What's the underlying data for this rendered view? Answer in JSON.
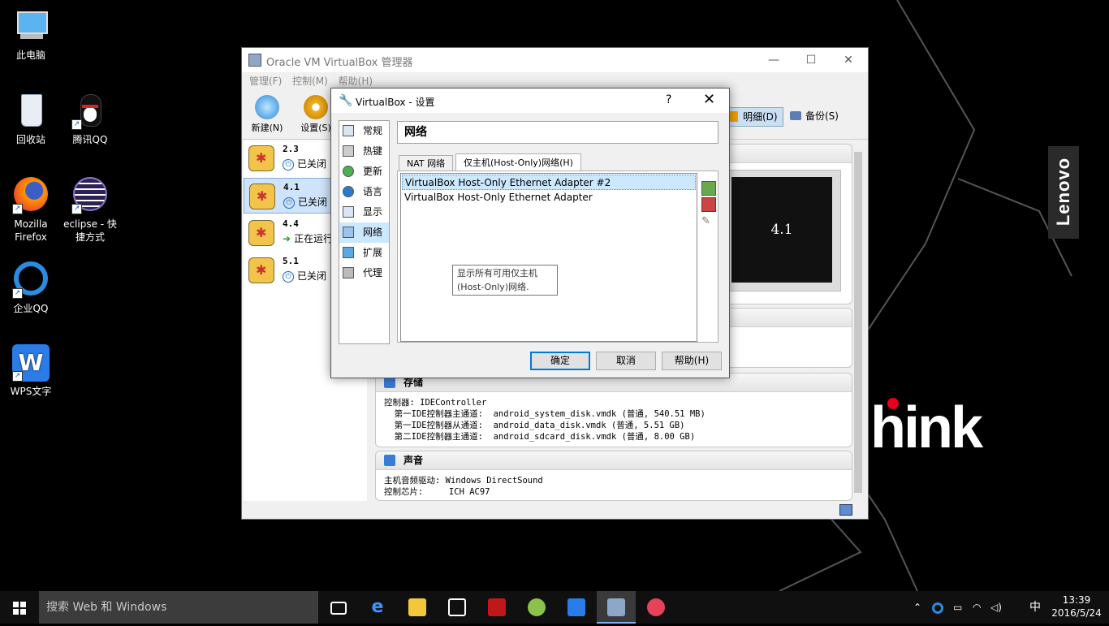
{
  "desktop": {
    "icons": [
      {
        "label": "此电脑",
        "icon": "computer-icon"
      },
      {
        "label": "回收站",
        "icon": "recycle-bin-icon"
      },
      {
        "label": "腾讯QQ",
        "icon": "qq-icon"
      },
      {
        "label": "Mozilla Firefox",
        "icon": "firefox-icon"
      },
      {
        "label": "eclipse - 快捷方式",
        "icon": "eclipse-icon"
      },
      {
        "label": "企业QQ",
        "icon": "enterprise-qq-icon"
      },
      {
        "label": "WPS文字",
        "icon": "wps-icon"
      }
    ],
    "wallpaper_brand": "Lenovo",
    "wallpaper_text": "hink"
  },
  "main_window": {
    "title": "Oracle VM VirtualBox 管理器",
    "menu": [
      "管理(F)",
      "控制(M)",
      "帮助(H)"
    ],
    "toolbar": {
      "new_label": "新建(N)",
      "settings_label": "设置(S)",
      "details_label": "明细(D)",
      "snapshots_label": "备份(S)"
    },
    "vms": [
      {
        "name": "2.3",
        "state": "已关闭",
        "state_icon": "power-off-icon"
      },
      {
        "name": "4.1",
        "state": "已关闭",
        "state_icon": "power-off-icon",
        "selected": true
      },
      {
        "name": "4.4",
        "state": "正在运行",
        "state_icon": "running-arrow-icon"
      },
      {
        "name": "5.1",
        "state": "已关闭",
        "state_icon": "power-off-icon"
      }
    ],
    "preview_text": "4.1",
    "storage": {
      "title": "存储",
      "lines": "控制器: IDEController\n  第一IDE控制器主通道:  android_system_disk.vmdk (普通, 540.51 MB)\n  第一IDE控制器从通道:  android_data_disk.vmdk (普通, 5.51 GB)\n  第二IDE控制器主通道:  android_sdcard_disk.vmdk (普通, 8.00 GB)"
    },
    "audio": {
      "title": "声音",
      "lines": "主机音频驱动: Windows DirectSound\n控制芯片:     ICH AC97"
    }
  },
  "dialog": {
    "title": "VirtualBox - 设置",
    "help_glyph": "?",
    "close_glyph": "✕",
    "categories": [
      {
        "label": "常规",
        "icon": "general-icon"
      },
      {
        "label": "热键",
        "icon": "hotkey-icon"
      },
      {
        "label": "更新",
        "icon": "update-icon"
      },
      {
        "label": "语言",
        "icon": "language-icon"
      },
      {
        "label": "显示",
        "icon": "display-icon"
      },
      {
        "label": "网络",
        "icon": "network-icon",
        "selected": true
      },
      {
        "label": "扩展",
        "icon": "extension-icon"
      },
      {
        "label": "代理",
        "icon": "proxy-icon"
      }
    ],
    "page_title": "网络",
    "tabs": [
      "NAT 网络",
      "仅主机(Host-Only)网络(H)"
    ],
    "active_tab": 1,
    "adapters": [
      "VirtualBox Host-Only Ethernet Adapter #2",
      "VirtualBox Host-Only Ethernet Adapter"
    ],
    "tooltip": "显示所有可用仅主机(Host-Only)网络.",
    "buttons": {
      "ok": "确定",
      "cancel": "取消",
      "help": "帮助(H)"
    }
  },
  "taskbar": {
    "search_placeholder": "搜索 Web 和 Windows",
    "tray_ime": "中",
    "time": "13:39",
    "date": "2016/5/24"
  },
  "colors": {
    "accent": "#0078d7",
    "selection": "#cce8ff",
    "taskbar": "#101010"
  }
}
